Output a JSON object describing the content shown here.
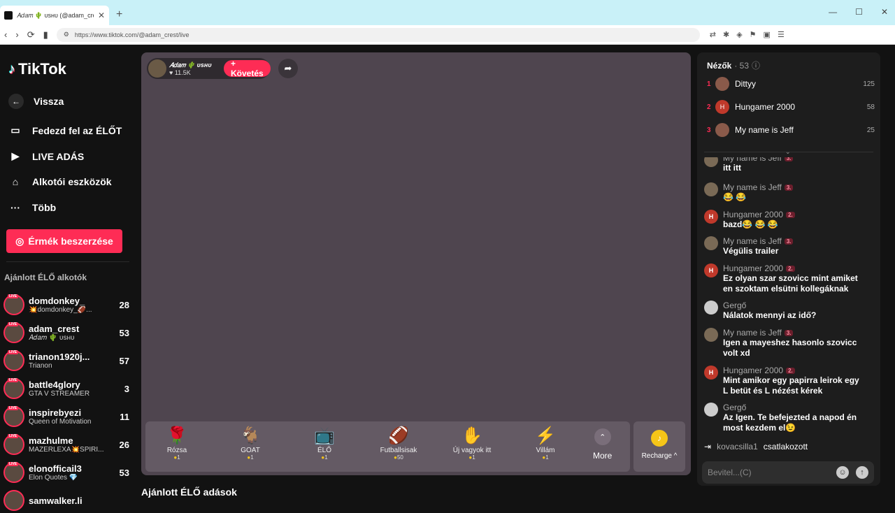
{
  "browser": {
    "tab_title": "𝐴𝑑𝑎𝑚 🌵 ᴜsʜᴜ (@adam_crest) Él...",
    "new_tab": "+",
    "url": "https://www.tiktok.com/@adam_crest/live",
    "nav_back": "‹",
    "nav_forward": "›",
    "nav_reload": "⟳"
  },
  "sidebar": {
    "logo": "TikTok",
    "back": "Vissza",
    "menu": [
      {
        "label": "Fedezd fel az ÉLŐT",
        "icon": "tv-icon"
      },
      {
        "label": "LIVE ADÁS",
        "icon": "camera-icon"
      },
      {
        "label": "Alkotói eszközök",
        "icon": "home-icon"
      },
      {
        "label": "Több",
        "icon": "more-icon"
      }
    ],
    "coins_button": "Érmék beszerzése",
    "recommended_title": "Ajánlott ÉLŐ alkotók",
    "creators": [
      {
        "name": "domdonkey_",
        "sub": "💥domdonkey_🏈...",
        "count": "28"
      },
      {
        "name": "adam_crest",
        "sub": "𝐴𝑑𝑎𝑚 🌵 ᴜsʜᴜ",
        "count": "53"
      },
      {
        "name": "trianon1920j...",
        "sub": "Trianon",
        "count": "57"
      },
      {
        "name": "battle4glory",
        "sub": "GTA V STREAMER",
        "count": "3"
      },
      {
        "name": "inspirebyezi",
        "sub": "Queen of Motivation",
        "count": "11"
      },
      {
        "name": "mazhulme",
        "sub": "MAZERLEXA💥SPIRI...",
        "count": "26"
      },
      {
        "name": "elonofficail3",
        "sub": "Elon Quotes 💎",
        "count": "53"
      },
      {
        "name": "samwalker.li",
        "sub": "",
        "count": ""
      }
    ]
  },
  "stream": {
    "host_name": "𝐴𝑑𝑎𝑚 🌵 ᴜsʜᴜ",
    "host_likes": "♥ 11.5K",
    "follow": "+ Követés",
    "gifts": [
      {
        "name": "Rózsa",
        "price": "1",
        "icon": "🌹"
      },
      {
        "name": "GOAT",
        "price": "1",
        "icon": "🐐"
      },
      {
        "name": "ÉLŐ",
        "price": "1",
        "icon": "📺"
      },
      {
        "name": "Futballsisak",
        "price": "50",
        "icon": "🏈"
      },
      {
        "name": "Új vagyok itt",
        "price": "1",
        "icon": "✋"
      },
      {
        "name": "Villám",
        "price": "1",
        "icon": "⚡"
      }
    ],
    "more": "More",
    "recharge": "Recharge ^",
    "below_title": "Ajánlott ÉLŐ adások"
  },
  "chat": {
    "viewers_label": "Nézők",
    "viewers_count": "· 53",
    "top_viewers": [
      {
        "rank": "1",
        "name": "Dittyy",
        "score": "125",
        "initial": ""
      },
      {
        "rank": "2",
        "name": "Hungamer 2000",
        "score": "58",
        "initial": "H"
      },
      {
        "rank": "3",
        "name": "My name is Jeff",
        "score": "25",
        "initial": ""
      }
    ],
    "messages": [
      {
        "user": "My name is Jeff",
        "badge": "3.",
        "text": "itt itt",
        "initial": ""
      },
      {
        "user": "My name is Jeff",
        "badge": "3.",
        "text": "😂 😂",
        "initial": ""
      },
      {
        "user": "Hungamer 2000",
        "badge": "2.",
        "text": "bazd😂 😂 😂",
        "initial": "H"
      },
      {
        "user": "My name is Jeff",
        "badge": "3.",
        "text": "Végülis trailer",
        "initial": ""
      },
      {
        "user": "Hungamer 2000",
        "badge": "2.",
        "text": "Ez olyan szar szovicc mint amiket en szoktam elsütni kollegáknak",
        "initial": "H"
      },
      {
        "user": "Gergő",
        "badge": "",
        "text": "Nálatok mennyi az idő?",
        "initial": ""
      },
      {
        "user": "My name is Jeff",
        "badge": "3.",
        "text": "Igen a mayeshez hasonlo szovicc volt xd",
        "initial": ""
      },
      {
        "user": "Hungamer 2000",
        "badge": "2.",
        "text": "Mint amikor egy papirra leirok egy L betüt és L nézést kérek",
        "initial": "H"
      },
      {
        "user": "Gergő",
        "badge": "",
        "text": "Az Igen. Te befejezted a napod én most kezdem el😉",
        "initial": ""
      }
    ],
    "joined_user": "kovacsilla1",
    "joined_text": "csatlakozott",
    "input_placeholder": "Bevitel...(C)"
  }
}
